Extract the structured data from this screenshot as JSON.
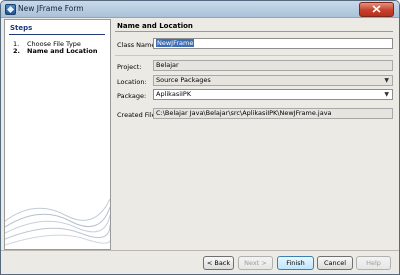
{
  "window": {
    "title": "New JFrame Form"
  },
  "steps": {
    "heading": "Steps",
    "items": [
      {
        "num": "1.",
        "label": "Choose File Type"
      },
      {
        "num": "2.",
        "label": "Name and Location"
      }
    ]
  },
  "section": {
    "title": "Name and Location"
  },
  "form": {
    "class_name": {
      "label": "Class Name:",
      "value": "NewJFrame"
    },
    "project": {
      "label": "Project:",
      "value": "Belajar"
    },
    "location": {
      "label": "Location:",
      "value": "Source Packages"
    },
    "package": {
      "label": "Package:",
      "value": "AplikasiIPK"
    },
    "created_file": {
      "label": "Created File:",
      "value": "C:\\Belajar Java\\Belajar\\src\\AplikasiIPK\\NewJFrame.java"
    }
  },
  "buttons": {
    "back": "< Back",
    "next": "Next >",
    "finish": "Finish",
    "cancel": "Cancel",
    "help": "Help"
  },
  "icons": {
    "window": "app-icon",
    "close": "close-icon",
    "dropdown": "chevron-down-icon"
  }
}
